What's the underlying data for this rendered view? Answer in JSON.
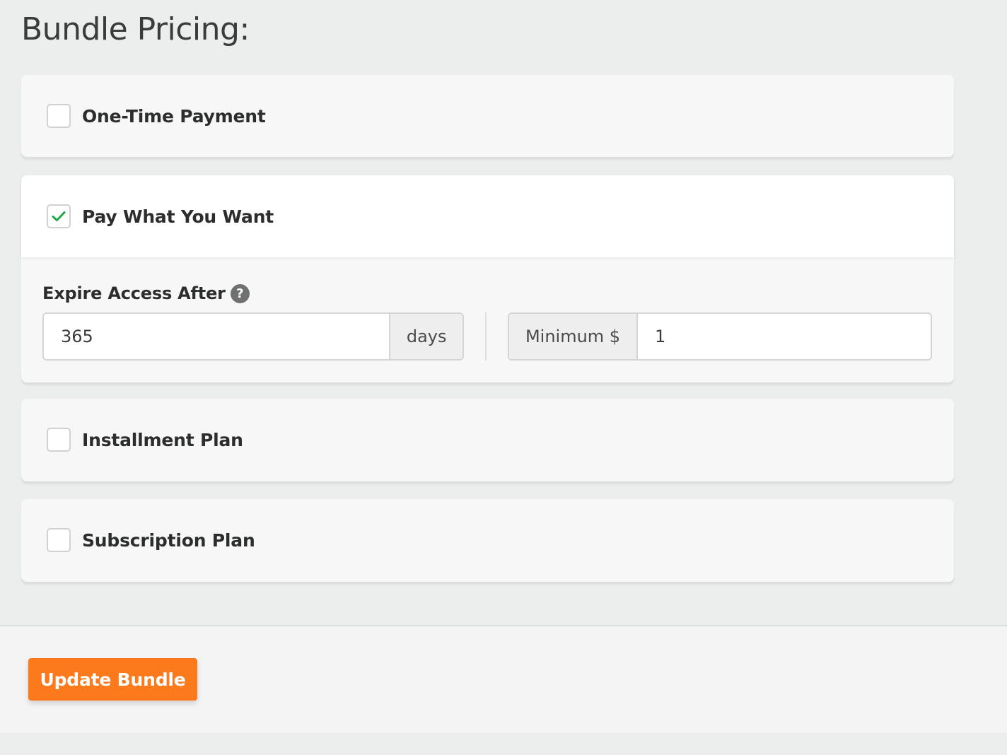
{
  "page": {
    "title": "Bundle Pricing:"
  },
  "pricing_options": [
    {
      "label": "One-Time Payment",
      "checked": false
    },
    {
      "label": "Pay What You Want",
      "checked": true
    },
    {
      "label": "Installment Plan",
      "checked": false
    },
    {
      "label": "Subscription Plan",
      "checked": false
    }
  ],
  "pay_what_you_want": {
    "expire_label": "Expire Access After",
    "help_icon": "question-circle-icon",
    "help_glyph": "?",
    "expire_value": "365",
    "expire_unit": "days",
    "minimum_label": "Minimum $",
    "minimum_value": "1"
  },
  "footer": {
    "update_button_label": "Update Bundle"
  },
  "colors": {
    "accent": "#fd7a1c",
    "check": "#22a845",
    "background": "#ebeeed"
  }
}
